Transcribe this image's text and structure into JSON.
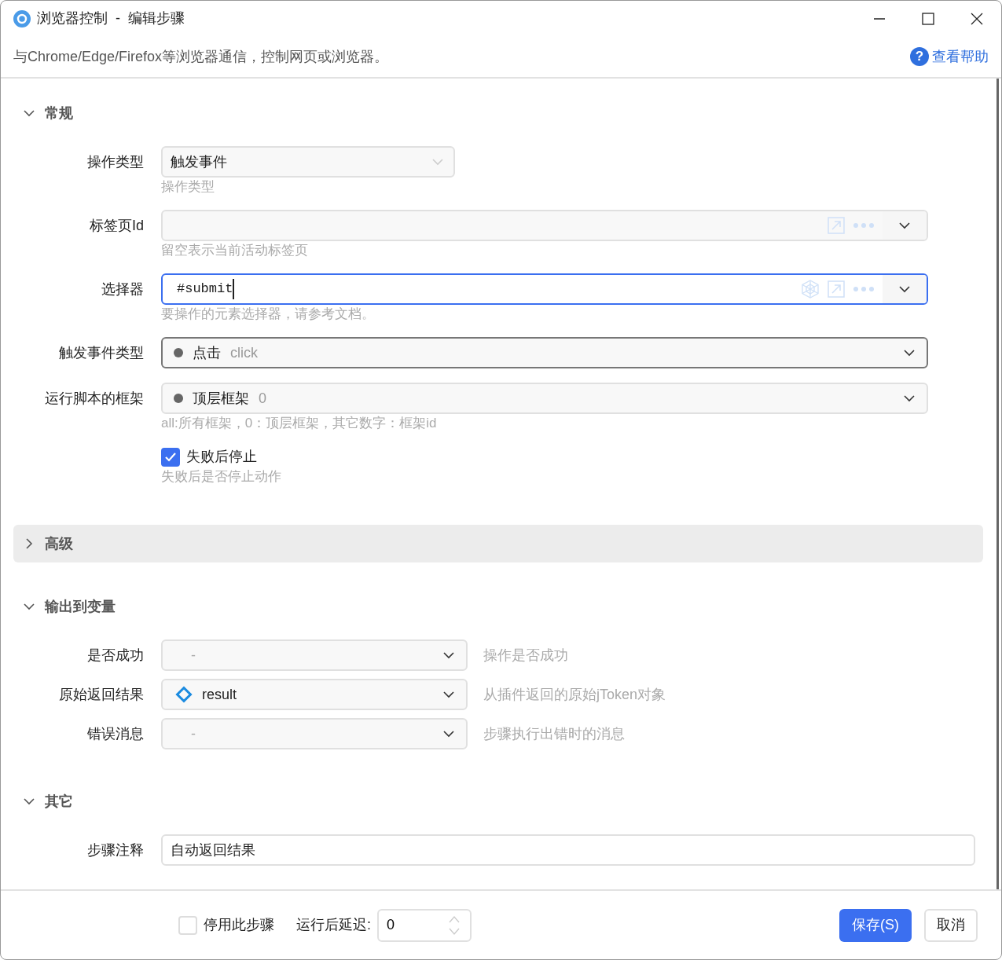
{
  "window": {
    "title": "浏览器控制  -  编辑步骤"
  },
  "description": "与Chrome/Edge/Firefox等浏览器通信，控制网页或浏览器。",
  "help": {
    "icon": "?",
    "label": "查看帮助"
  },
  "sections": [
    {
      "title": "常规",
      "expanded": true,
      "highlighted": false,
      "fields": [
        {
          "kind": "select",
          "label": "操作类型",
          "value": "触发事件",
          "hint": "操作类型"
        },
        {
          "kind": "combo",
          "label": "标签页Id",
          "hint": "留空表示当前活动标签页",
          "focused": false,
          "element_picker": false
        },
        {
          "kind": "combo",
          "label": "选择器",
          "value": "#submit",
          "hint": "要操作的元素选择器，请参考文档。",
          "focused": true,
          "element_picker": true
        },
        {
          "kind": "option",
          "label": "触发事件类型",
          "value": "点击",
          "code": "click",
          "hovered": true
        },
        {
          "kind": "option",
          "label": "运行脚本的框架",
          "value": "顶层框架",
          "code": "0",
          "hint": "all:所有框架，0：顶层框架，其它数字：框架id",
          "hovered": false
        },
        {
          "kind": "checkbox",
          "label": "失败后停止",
          "checked": true,
          "hint": "失败后是否停止动作"
        }
      ]
    },
    {
      "title": "高级",
      "expanded": false,
      "highlighted": true
    },
    {
      "title": "输出到变量",
      "expanded": true,
      "highlighted": false,
      "fields": [
        {
          "kind": "variable",
          "label": "是否成功",
          "value": "-",
          "assigned": false,
          "hint": "操作是否成功"
        },
        {
          "kind": "variable",
          "label": "原始返回结果",
          "value": "result",
          "assigned": true,
          "hint": "从插件返回的原始jToken对象"
        },
        {
          "kind": "variable",
          "label": "错误消息",
          "value": "-",
          "assigned": false,
          "hint": "步骤执行出错时的消息"
        }
      ]
    },
    {
      "title": "其它",
      "expanded": true,
      "highlighted": false,
      "fields": [
        {
          "kind": "text",
          "label": "步骤注释",
          "value": "自动返回结果"
        }
      ]
    }
  ],
  "footer": {
    "disable": {
      "label": "停用此步骤",
      "checked": false
    },
    "delay": {
      "label": "运行后延迟:",
      "value": "0"
    },
    "buttons": [
      {
        "label": "保存(S)",
        "primary": true
      },
      {
        "label": "取消",
        "primary": false
      }
    ]
  }
}
